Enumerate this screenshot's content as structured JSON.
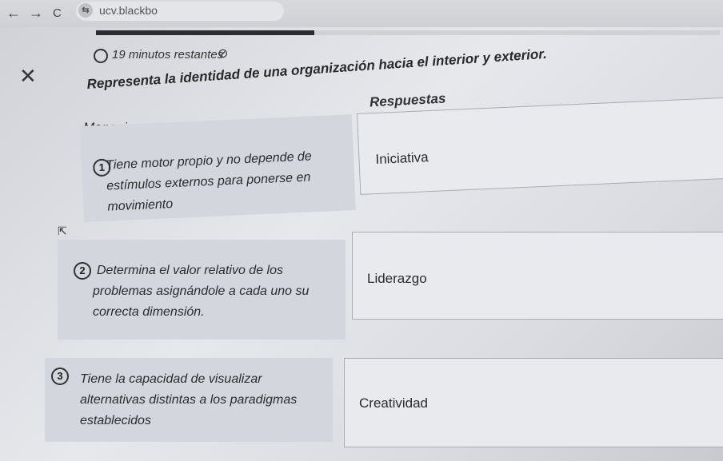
{
  "browser": {
    "back": "←",
    "forward": "→",
    "reload": "C",
    "url": "ucv.blackbo"
  },
  "quiz": {
    "timer": "19 minutos restantes",
    "question": "Representa la identidad de una organización hacia el interior y exterior.",
    "messages_header": "Mensajes",
    "answers_header": "Respuestas",
    "progress_fraction": 0.35
  },
  "messages": [
    {
      "number": "1",
      "text": "Tiene motor propio y no depende de estímulos externos para ponerse en movimiento"
    },
    {
      "number": "2",
      "text": "Determina el valor relativo de los problemas asignándole a cada uno su correcta dimensión."
    },
    {
      "number": "3",
      "text": "Tiene la capacidad de visualizar alternativas distintas a los paradigmas establecidos"
    }
  ],
  "answers": [
    "Iniciativa",
    "Liderazgo",
    "Creatividad"
  ]
}
